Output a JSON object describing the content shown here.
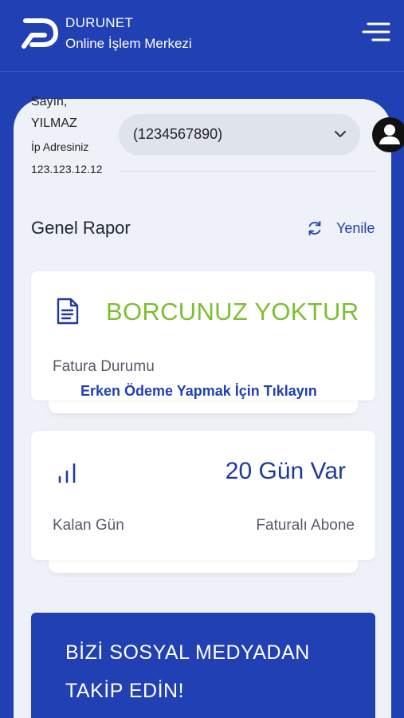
{
  "header": {
    "brand_name": "DURUNET",
    "brand_sub": "Online İşlem Merkezi",
    "icons": [
      "durunet-logo-icon",
      "menu-icon"
    ]
  },
  "user": {
    "greeting": "Sayın,",
    "name": "YILMAZ",
    "ip_label": "İp Adresiniz",
    "ip_value": "123.123.12.12",
    "subscriber_select": "(1234567890)"
  },
  "report": {
    "title": "Genel Rapor",
    "refresh_label": "Yenile",
    "invoice": {
      "status": "BORCUNUZ YOKTUR",
      "label": "Fatura Durumu",
      "early_payment_link": "Erken Ödeme Yapmak İçin Tıklayın"
    },
    "days": {
      "value": "20 Gün Var",
      "label": "Kalan Gün",
      "type": "Faturalı Abone"
    }
  },
  "social": {
    "line1": "BİZİ SOSYAL MEDYADAN",
    "line2": "TAKİP EDİN!"
  },
  "colors": {
    "primary": "#2140b4",
    "success": "#7dbf30",
    "background": "#eef1f7"
  }
}
